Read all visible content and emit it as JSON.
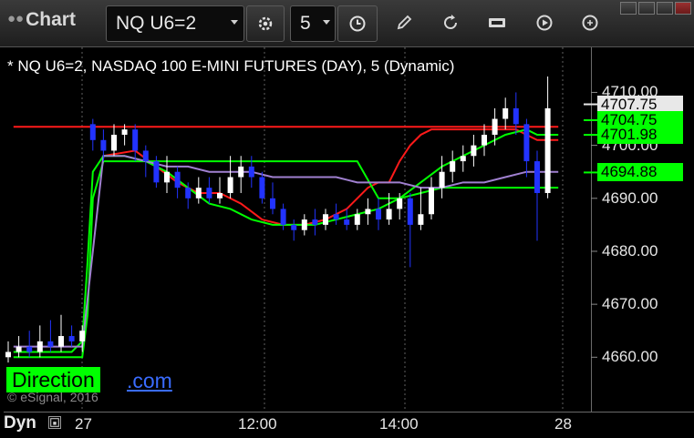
{
  "toolbar": {
    "app_title": "Chart",
    "symbol": "NQ U6=2",
    "interval": "5"
  },
  "chart_header": "* NQ U6=2, NASDAQ 100 E-MINI FUTURES (DAY), 5 (Dynamic)",
  "watermark": {
    "brand_green": "Direction",
    "brand_blue": ".com",
    "copyright": "© eSignal, 2016"
  },
  "footer": {
    "mode_label": "Dyn"
  },
  "price_axis": {
    "ticks": [
      "4710.00",
      "4700.00",
      "4690.00",
      "4680.00",
      "4670.00",
      "4660.00"
    ]
  },
  "price_tags": [
    {
      "label": "4707.75",
      "value": 4707.75,
      "bg": "#e8e8e8",
      "fg": "#000000"
    },
    {
      "label": "4704.75",
      "value": 4704.75,
      "bg": "#00ff00",
      "fg": "#000000"
    },
    {
      "label": "4701.98",
      "value": 4701.98,
      "bg": "#00ff00",
      "fg": "#000000"
    },
    {
      "label": "4694.88",
      "value": 4694.88,
      "bg": "#00ff00",
      "fg": "#000000"
    }
  ],
  "time_axis": {
    "ticks": [
      "27",
      "12:00",
      "14:00",
      "28"
    ]
  },
  "colors": {
    "up_candle": "#ffffff",
    "down_candle": "#2233ff",
    "red_line": "#ff1a1a",
    "green_line": "#00ff00",
    "purple_line": "#a080d0"
  },
  "icons": [
    "dropdown-caret-icon",
    "settings-gear-icon",
    "clock-icon",
    "pencil-icon",
    "refresh-icon",
    "get-icon",
    "play-icon",
    "minimize-icon",
    "maximize-icon",
    "close-icon",
    "lock-icon"
  ],
  "chart_data": {
    "type": "candlestick",
    "y_range": [
      4653,
      4713
    ],
    "series": [
      {
        "name": "",
        "color": "#ff1a1a",
        "x": [
          0.5,
          7,
          9,
          11,
          13,
          15,
          17,
          20,
          23,
          26,
          29,
          32,
          34,
          36,
          38,
          40,
          42,
          44,
          46,
          48,
          49,
          50,
          51,
          52
        ],
        "y": [
          4703.5,
          4703.5,
          4703.5,
          4703.5,
          4703.5,
          4703.5,
          4703.5,
          4703.5,
          4703.5,
          4703.5,
          4703.5,
          4703.5,
          4703.5,
          4703.5,
          4703.5,
          4703.5,
          4703.5,
          4703.5,
          4703.5,
          4703.5,
          4703.5,
          4703.5,
          4703.5,
          4703.5
        ]
      },
      {
        "name": "",
        "color": "#ff1a1a",
        "x": [
          9,
          12,
          14,
          16,
          18,
          20,
          22,
          24,
          26,
          28,
          30,
          32,
          34,
          35,
          36,
          37,
          38,
          39,
          40,
          42,
          44,
          46,
          48,
          49,
          50,
          51,
          52
        ],
        "y": [
          4698,
          4699,
          4696,
          4693,
          4691,
          4691,
          4689,
          4686,
          4685,
          4685,
          4686,
          4688,
          4692,
          4693,
          4693,
          4697,
          4700,
          4702,
          4703,
          4703,
          4703,
          4703,
          4703,
          4702,
          4701,
          4701,
          4701
        ]
      },
      {
        "name": "",
        "color": "#00ff00",
        "x": [
          0.5,
          2,
          4,
          6,
          7,
          7.5,
          8,
          9,
          11,
          13,
          15,
          17,
          19,
          21,
          23,
          25,
          27,
          29,
          31,
          33,
          35,
          37,
          39,
          41,
          43,
          45,
          47,
          49,
          50,
          51,
          52
        ],
        "y": [
          4661,
          4661,
          4661,
          4661,
          4663,
          4678,
          4695,
          4698,
          4698,
          4697,
          4695,
          4692,
          4689,
          4688,
          4686,
          4685,
          4685,
          4685,
          4686,
          4687,
          4688,
          4690,
          4693,
          4696,
          4698,
          4700,
          4702,
          4703,
          4702,
          4702,
          4702
        ]
      },
      {
        "name": "",
        "color": "#00ff00",
        "x": [
          0.5,
          2,
          4,
          6,
          7,
          7.5,
          8,
          9,
          11,
          13,
          15,
          17,
          19,
          21,
          23,
          25,
          27,
          29,
          31,
          33,
          35,
          37,
          39,
          41,
          43,
          45,
          47,
          49,
          50,
          51,
          52
        ],
        "y": [
          4660,
          4660,
          4660,
          4660,
          4660,
          4668,
          4690,
          4697,
          4697,
          4697,
          4697,
          4697,
          4697,
          4697,
          4697,
          4697,
          4697,
          4697,
          4697,
          4697,
          4690,
          4690,
          4691,
          4692,
          4692,
          4692,
          4692,
          4692,
          4692,
          4692,
          4692
        ]
      },
      {
        "name": "",
        "color": "#a080d0",
        "x": [
          0.5,
          6,
          7,
          9,
          11,
          13,
          15,
          17,
          19,
          21,
          23,
          25,
          27,
          29,
          31,
          33,
          35,
          37,
          39,
          41,
          43,
          45,
          47,
          49,
          50,
          51,
          52
        ],
        "y": [
          4662,
          4662,
          4662,
          4698,
          4698,
          4697,
          4696,
          4696,
          4695,
          4695,
          4695,
          4694,
          4694,
          4694,
          4694,
          4693,
          4693,
          4693,
          4692,
          4692,
          4693,
          4693,
          4694,
          4695,
          4695,
          4695,
          4695
        ]
      }
    ],
    "candles": [
      [
        4660,
        4661,
        4663,
        4659
      ],
      [
        4661,
        4662,
        4664,
        4660
      ],
      [
        4662,
        4661,
        4665,
        4660
      ],
      [
        4661,
        4663,
        4666,
        4660
      ],
      [
        4663,
        4662,
        4667,
        4661
      ],
      [
        4662,
        4664,
        4668,
        4661
      ],
      [
        4664,
        4663,
        4666,
        4662
      ],
      [
        4663,
        4665,
        4666,
        4661
      ],
      [
        4704,
        4701,
        4705,
        4699
      ],
      [
        4701,
        4699,
        4703,
        4697
      ],
      [
        4699,
        4702,
        4704,
        4698
      ],
      [
        4702,
        4703,
        4704,
        4700
      ],
      [
        4703,
        4699,
        4704,
        4697
      ],
      [
        4699,
        4697,
        4700,
        4694
      ],
      [
        4697,
        4693,
        4698,
        4692
      ],
      [
        4693,
        4695,
        4698,
        4691
      ],
      [
        4695,
        4692,
        4696,
        4690
      ],
      [
        4692,
        4690,
        4693,
        4688
      ],
      [
        4690,
        4692,
        4694,
        4689
      ],
      [
        4692,
        4690,
        4694,
        4689
      ],
      [
        4690,
        4691,
        4694,
        4689
      ],
      [
        4691,
        4694,
        4698,
        4690
      ],
      [
        4694,
        4696,
        4698,
        4691
      ],
      [
        4696,
        4694,
        4698,
        4692
      ],
      [
        4694,
        4690,
        4695,
        4689
      ],
      [
        4690,
        4688,
        4693,
        4687
      ],
      [
        4688,
        4685,
        4689,
        4684
      ],
      [
        4685,
        4684,
        4686,
        4682
      ],
      [
        4684,
        4686,
        4687,
        4683
      ],
      [
        4686,
        4685,
        4688,
        4683
      ],
      [
        4685,
        4687,
        4688,
        4684
      ],
      [
        4687,
        4686,
        4689,
        4685
      ],
      [
        4686,
        4685,
        4688,
        4684
      ],
      [
        4685,
        4687,
        4688,
        4684
      ],
      [
        4687,
        4688,
        4690,
        4685
      ],
      [
        4688,
        4686,
        4690,
        4684
      ],
      [
        4686,
        4688,
        4691,
        4685
      ],
      [
        4688,
        4690,
        4691,
        4686
      ],
      [
        4690,
        4685,
        4691,
        4677
      ],
      [
        4685,
        4687,
        4692,
        4684
      ],
      [
        4687,
        4692,
        4694,
        4686
      ],
      [
        4692,
        4695,
        4698,
        4690
      ],
      [
        4695,
        4697,
        4699,
        4693
      ],
      [
        4697,
        4698,
        4700,
        4695
      ],
      [
        4698,
        4700,
        4702,
        4696
      ],
      [
        4700,
        4702,
        4704,
        4698
      ],
      [
        4702,
        4705,
        4707,
        4700
      ],
      [
        4705,
        4707,
        4709,
        4703
      ],
      [
        4707,
        4704,
        4710,
        4702
      ],
      [
        4704,
        4697,
        4705,
        4694
      ],
      [
        4697,
        4691,
        4699,
        4682
      ],
      [
        4691,
        4707,
        4713,
        4690
      ]
    ]
  }
}
